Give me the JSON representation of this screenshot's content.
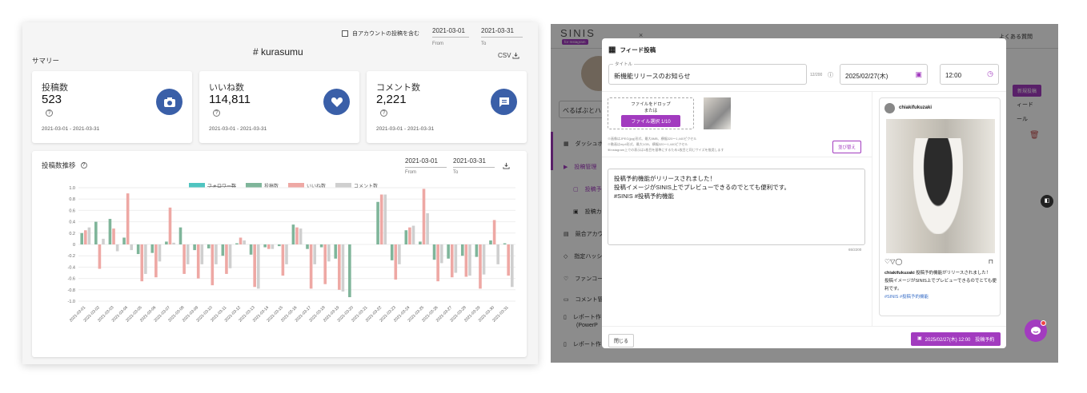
{
  "left": {
    "hashtag": "# kurasumu",
    "summary_label": "サマリー",
    "own_posts_label": "自アカウントの投稿を含む",
    "date_from": "2021-03-01",
    "date_to": "2021-03-31",
    "from_label": "From",
    "to_label": "To",
    "csv_label": "CSV",
    "stats": [
      {
        "label": "投稿数",
        "value": "523",
        "range": "2021-03-01 - 2021-03-31",
        "icon": "camera-plus-icon"
      },
      {
        "label": "いいね数",
        "value": "114,811",
        "range": "2021-03-01 - 2021-03-31",
        "icon": "heart-icon"
      },
      {
        "label": "コメント数",
        "value": "2,221",
        "range": "2021-03-01 - 2021-03-31",
        "icon": "comment-icon"
      }
    ],
    "trend_title": "投稿数推移"
  },
  "chart_data": {
    "type": "bar",
    "legend": [
      "フォロワー数",
      "投稿数",
      "いいね数",
      "コメント数"
    ],
    "colors": [
      "#4fc4c0",
      "#7fb59a",
      "#eea8a4",
      "#cfcfcf"
    ],
    "categories": [
      "2021-03-01",
      "2021-03-02",
      "2021-03-03",
      "2021-03-04",
      "2021-03-05",
      "2021-03-06",
      "2021-03-07",
      "2021-03-08",
      "2021-03-09",
      "2021-03-10",
      "2021-03-11",
      "2021-03-12",
      "2021-03-13",
      "2021-03-14",
      "2021-03-15",
      "2021-03-16",
      "2021-03-17",
      "2021-03-18",
      "2021-03-19",
      "2021-03-20",
      "2021-03-21",
      "2021-03-22",
      "2021-03-23",
      "2021-03-24",
      "2021-03-25",
      "2021-03-26",
      "2021-03-27",
      "2021-03-28",
      "2021-03-29",
      "2021-03-30",
      "2021-03-31"
    ],
    "series": [
      {
        "name": "フォロワー数",
        "values": [
          0.2,
          0.4,
          0.45,
          0.12,
          -0.17,
          -0.15,
          0.05,
          0.3,
          -0.1,
          -0.07,
          -0.2,
          0.02,
          -0.18,
          -0.05,
          -0.03,
          0.35,
          -0.08,
          -0.05,
          -0.25,
          -0.93,
          0,
          0.75,
          -0.28,
          0.25,
          0.05,
          -0.27,
          -0.25,
          -0.2,
          -0.22,
          0.07,
          0.02
        ]
      },
      {
        "name": "投稿数",
        "values": [
          0.25,
          -0.43,
          0.28,
          0.9,
          -0.65,
          -0.58,
          0.65,
          -0.52,
          -0.6,
          -0.72,
          -0.52,
          0.12,
          -0.75,
          -0.08,
          -0.55,
          0.3,
          -0.78,
          -0.7,
          -0.8,
          0,
          0,
          0.88,
          -0.62,
          0.3,
          0.98,
          -0.65,
          -0.58,
          -0.57,
          -0.78,
          0.43,
          -0.55
        ]
      },
      {
        "name": "いいね数",
        "values": [
          0.3,
          0.1,
          -0.12,
          -0.1,
          -0.52,
          -0.3,
          0.03,
          -0.35,
          -0.35,
          -0.35,
          -0.42,
          0.07,
          -0.78,
          -0.08,
          -0.35,
          0.28,
          -0.35,
          -0.3,
          -0.83,
          0,
          0,
          0.88,
          -0.35,
          0.33,
          0.55,
          -0.33,
          -0.5,
          -0.55,
          -0.53,
          -0.35,
          -0.75
        ]
      }
    ],
    "ylim": [
      -1.0,
      1.0
    ],
    "yticks": [
      "1.0",
      "0.8",
      "0.6",
      "0.4",
      "0.2",
      "0",
      "-0.2",
      "-0.4",
      "-0.6",
      "-0.8",
      "-1.0"
    ]
  },
  "right": {
    "logo": "SINIS",
    "logo_sub": "for Instagram",
    "top_right": "よくある質問",
    "modal_title": "フィード投稿",
    "title_label": "タイトル",
    "title_value": "新機能リリースのお知らせ",
    "title_count": "12/200",
    "date_value": "2025/02/27(木)",
    "time_value": "12:00",
    "drop_text": "ファイルをドロップ",
    "drop_or": "または",
    "file_button": "ファイル選択 1/10",
    "note1": "※画像はJPEG(jpg)形式、最大8MB、横幅320〜1,440ピクセル",
    "note2": "※動画はmp4形式、最大1GB、横幅320〜1,440ピクセル",
    "note3": "※Instagram上での表示は1枚目を基準にするため1枚目と同じサイズを推奨します",
    "reorder": "並び替え",
    "body_line1": "投稿予約機能がリリースされました！",
    "body_line2": "投稿イメージがSINIS上でプレビューできるのでとても便利です。",
    "body_line3": "#SINIS #投稿予約機能",
    "body_count": "65/2200",
    "preview_user": "chiakifukuzaki",
    "preview_caption_user": "chiakifukuzaki",
    "preview_caption1": "投稿予約機能がリリースされました！",
    "preview_caption2": "投稿イメージがSINIS上でプレビューできるのでとても便利です。",
    "preview_tags": "#SINIS #投稿予約機能",
    "close": "閉じる",
    "schedule": "2025/02/27(木) 12:00　投稿予約",
    "account_name": "べるぱぶとハ",
    "sidebar": [
      "ダッシュボ",
      "投稿管理",
      "投稿予",
      "投稿カ",
      "競合アカウ",
      "指定ハッシ",
      "ファンコー",
      "コメント管",
      "レポート作",
      "(PowerP",
      "レポート作"
    ],
    "bg_button": "新規投稿",
    "bg_text1": "ィード",
    "bg_text2": "ール"
  }
}
